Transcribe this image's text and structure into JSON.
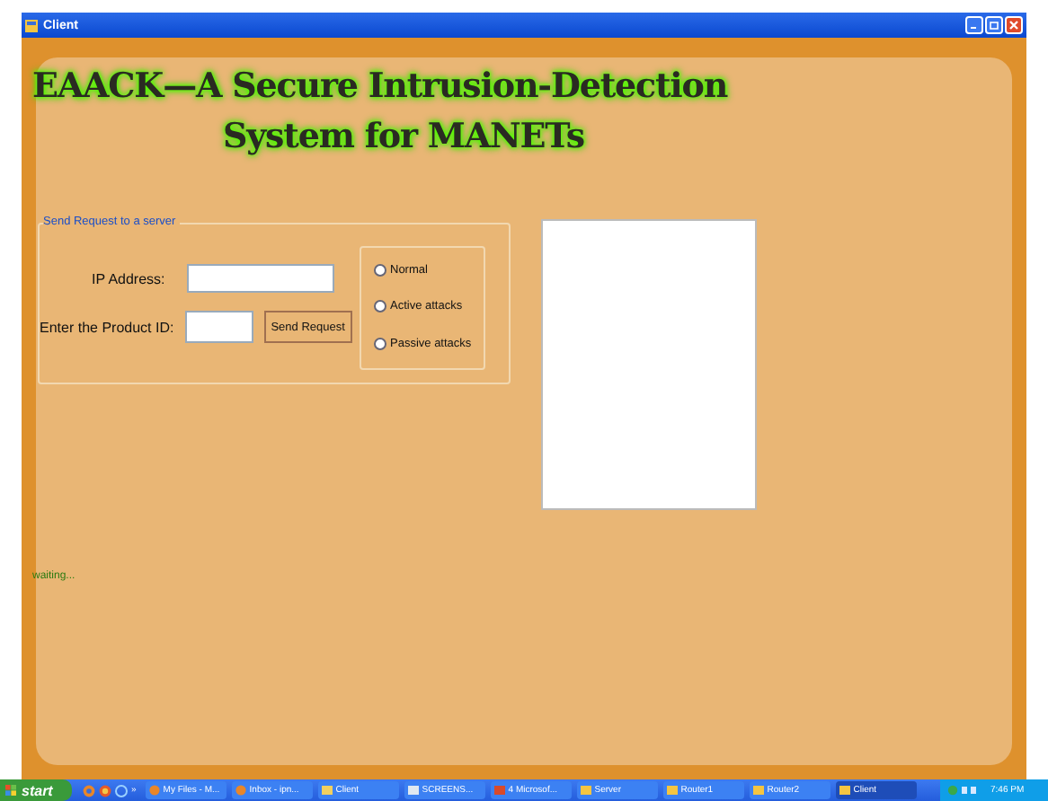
{
  "window": {
    "title": "Client"
  },
  "heading": {
    "line_1": "EAACK—A Secure Intrusion-Detection",
    "line_2": "System for MANETs"
  },
  "request_group": {
    "legend": "Send Request to a server",
    "ip_label": "IP Address:",
    "product_label": "Enter the Product ID:",
    "button": "Send Request",
    "options": [
      {
        "label": "Normal",
        "selected": false
      },
      {
        "label": "Active attacks",
        "selected": false
      },
      {
        "label": "Passive attacks",
        "selected": false
      }
    ]
  },
  "status": "waiting...",
  "taskbar": {
    "start": "start",
    "more": "»",
    "tasks": [
      {
        "label": "My Files - M...",
        "selected": false,
        "kind": "browser"
      },
      {
        "label": "Inbox - ipn...",
        "selected": false,
        "kind": "browser"
      },
      {
        "label": "Client",
        "selected": false,
        "kind": "folder"
      },
      {
        "label": "SCREENS...",
        "selected": false,
        "kind": "document"
      },
      {
        "label": "4 Microsof...",
        "selected": false,
        "kind": "group"
      },
      {
        "label": "Server",
        "selected": false,
        "kind": "app"
      },
      {
        "label": "Router1",
        "selected": false,
        "kind": "app"
      },
      {
        "label": "Router2",
        "selected": false,
        "kind": "app"
      },
      {
        "label": "Client",
        "selected": true,
        "kind": "app"
      }
    ],
    "clock": "7:46 PM"
  }
}
